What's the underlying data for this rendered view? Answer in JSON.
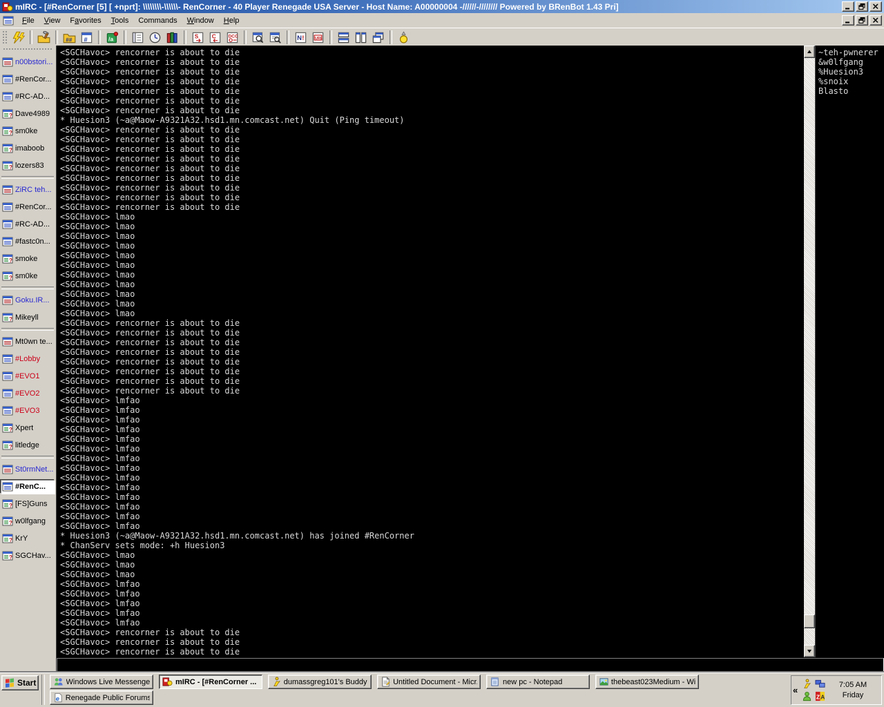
{
  "window": {
    "title": "mIRC - [#RenCorner [5] [ +nprt]: \\\\\\\\\\\\\\\\-\\\\\\\\\\\\- RenCorner - 40 Player Renegade USA Server - Host Name: A00000004 -//////-//////// Powered by BRenBot 1.43 Pri]"
  },
  "menu": {
    "items": [
      {
        "label": "File",
        "u": 0
      },
      {
        "label": "View",
        "u": 0
      },
      {
        "label": "Favorites",
        "u": 1
      },
      {
        "label": "Tools",
        "u": 0
      },
      {
        "label": "Commands",
        "u": -1
      },
      {
        "label": "Window",
        "u": 0
      },
      {
        "label": "Help",
        "u": 0
      }
    ]
  },
  "toolbar": {
    "buttons": [
      "connect-icon",
      "|",
      "options-icon",
      "|",
      "channels-folder-icon",
      "channel-list-icon",
      "|",
      "script-editor-icon",
      "|",
      "address-book-icon",
      "timer-icon",
      "help-books-icon",
      "|",
      "send-file-icon",
      "get-file-icon",
      "dcc-icon",
      "|",
      "find-text-icon",
      "search-log-icon",
      "|",
      "notify-list-icon",
      "url-list-icon",
      "|",
      "tile-horizontal-icon",
      "tile-vertical-icon",
      "cascade-icon",
      "|",
      "away-icon"
    ]
  },
  "switchbar": {
    "items": [
      {
        "label": "n00bstori...",
        "type": "status",
        "style": "blue"
      },
      {
        "label": "#RenCor...",
        "type": "channel",
        "style": "normal"
      },
      {
        "label": "#RC-AD...",
        "type": "channel",
        "style": "normal"
      },
      {
        "label": "Dave4989",
        "type": "query",
        "style": "normal"
      },
      {
        "label": "sm0ke",
        "type": "query",
        "style": "normal"
      },
      {
        "label": "imaboob",
        "type": "query",
        "style": "normal"
      },
      {
        "label": "lozers83",
        "type": "query",
        "style": "normal"
      },
      {
        "separator": true
      },
      {
        "label": "ZiRC teh...",
        "type": "status",
        "style": "blue"
      },
      {
        "label": "#RenCor...",
        "type": "channel",
        "style": "normal"
      },
      {
        "label": "#RC-AD...",
        "type": "channel",
        "style": "normal"
      },
      {
        "label": "#fastc0n...",
        "type": "channel",
        "style": "normal"
      },
      {
        "label": "smoke",
        "type": "query",
        "style": "normal"
      },
      {
        "label": "sm0ke",
        "type": "query",
        "style": "normal"
      },
      {
        "separator": true
      },
      {
        "label": "Goku.IR...",
        "type": "status",
        "style": "blue"
      },
      {
        "label": "Mikeyll",
        "type": "query",
        "style": "normal"
      },
      {
        "separator": true
      },
      {
        "label": "Mt0wn te...",
        "type": "status",
        "style": "normal"
      },
      {
        "label": "#Lobby",
        "type": "channel",
        "style": "red"
      },
      {
        "label": "#EVO1",
        "type": "channel",
        "style": "red"
      },
      {
        "label": "#EVO2",
        "type": "channel",
        "style": "red"
      },
      {
        "label": "#EVO3",
        "type": "channel",
        "style": "red"
      },
      {
        "label": "Xpert",
        "type": "query",
        "style": "normal"
      },
      {
        "label": "litledge",
        "type": "query",
        "style": "normal"
      },
      {
        "separator": true
      },
      {
        "label": "St0rmNet...",
        "type": "status",
        "style": "blue"
      },
      {
        "label": "#RenC...",
        "type": "channel",
        "style": "active"
      },
      {
        "label": "[FS]Guns",
        "type": "query",
        "style": "normal"
      },
      {
        "label": "w0lfgang",
        "type": "query",
        "style": "normal"
      },
      {
        "label": "KrY",
        "type": "query",
        "style": "normal"
      },
      {
        "label": "SGCHav...",
        "type": "query",
        "style": "normal"
      }
    ]
  },
  "chat": {
    "lines": [
      {
        "text": "<SGCHavoc> rencorner is about to die",
        "repeat": 7
      },
      {
        "text": "* Huesion3 (~a@Maow-A9321A32.hsd1.mn.comcast.net) Quit (Ping timeout)",
        "repeat": 1
      },
      {
        "text": "<SGCHavoc> rencorner is about to die",
        "repeat": 9
      },
      {
        "text": "<SGCHavoc> lmao",
        "repeat": 11
      },
      {
        "text": "<SGCHavoc> rencorner is about to die",
        "repeat": 8
      },
      {
        "text": "<SGCHavoc> lmfao",
        "repeat": 14
      },
      {
        "text": "* Huesion3 (~a@Maow-A9321A32.hsd1.mn.comcast.net) has joined #RenCorner",
        "repeat": 1
      },
      {
        "text": "* ChanServ sets mode: +h Huesion3",
        "repeat": 1
      },
      {
        "text": "<SGCHavoc> lmao",
        "repeat": 3
      },
      {
        "text": "<SGCHavoc> lmfao",
        "repeat": 5
      },
      {
        "text": "<SGCHavoc> rencorner is about to die",
        "repeat": 3
      }
    ]
  },
  "nicklist": {
    "nicks": [
      "~teh-pwnerer",
      "&w0lfgang",
      "%Huesion3",
      "%snoix",
      "Blasto"
    ]
  },
  "inputbox": {
    "value": ""
  },
  "taskbar": {
    "start_label": "Start",
    "row1": [
      {
        "label": "Windows Live Messenger",
        "icon": "wlm-icon",
        "active": false
      },
      {
        "label": "mIRC - [#RenCorner ...",
        "icon": "mirc-icon",
        "active": true
      },
      {
        "label": "dumassgreg101's Buddy ...",
        "icon": "aim-icon",
        "active": false
      },
      {
        "label": "Untitled Document - Micr...",
        "icon": "document-icon",
        "active": false
      },
      {
        "label": "new pc - Notepad",
        "icon": "notepad-icon",
        "active": false
      },
      {
        "label": "thebeast023Medium - Wi...",
        "icon": "image-icon",
        "active": false
      }
    ],
    "row2": [
      {
        "label": "Renegade Public Forums...",
        "icon": "ie-icon",
        "active": false
      }
    ],
    "tray": {
      "chevron": "«",
      "icons": [
        "aim-tray-icon",
        "network-tray-icon",
        "messenger-tray-icon",
        "zonealarm-tray-icon"
      ],
      "time": "7:05 AM",
      "day": "Friday"
    }
  },
  "colors": {
    "titlebar_gradient_left": "#1e50a0",
    "titlebar_gradient_right": "#a6caf0",
    "chrome": "#d4d0c8",
    "chat_background": "#000000",
    "chat_text": "#d8d8d8",
    "switchbar_event_blue": "#2828d0",
    "switchbar_activity_red": "#cc0018"
  }
}
